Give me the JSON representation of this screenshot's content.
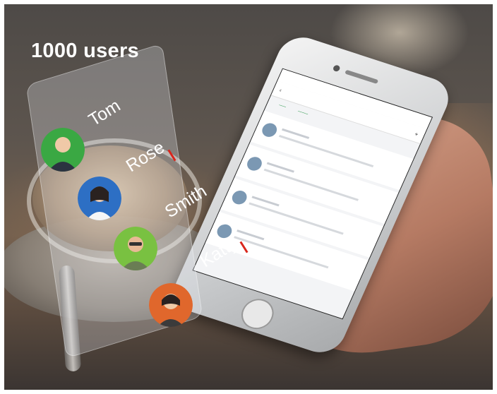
{
  "headline": "1000 users",
  "users": [
    {
      "name": "Tom",
      "avatar_bg": "#3aa843",
      "avatar_icon": "person-avatar"
    },
    {
      "name": "Rose",
      "avatar_bg": "#2d6fc4",
      "avatar_icon": "person-avatar"
    },
    {
      "name": "Smith",
      "avatar_bg": "#79c141",
      "avatar_icon": "person-avatar"
    },
    {
      "name": "Katty",
      "avatar_bg": "#e0672c",
      "avatar_icon": "person-avatar"
    }
  ],
  "colors": {
    "accent_green": "#2f9a4e",
    "badge_red": "#d9261c"
  }
}
